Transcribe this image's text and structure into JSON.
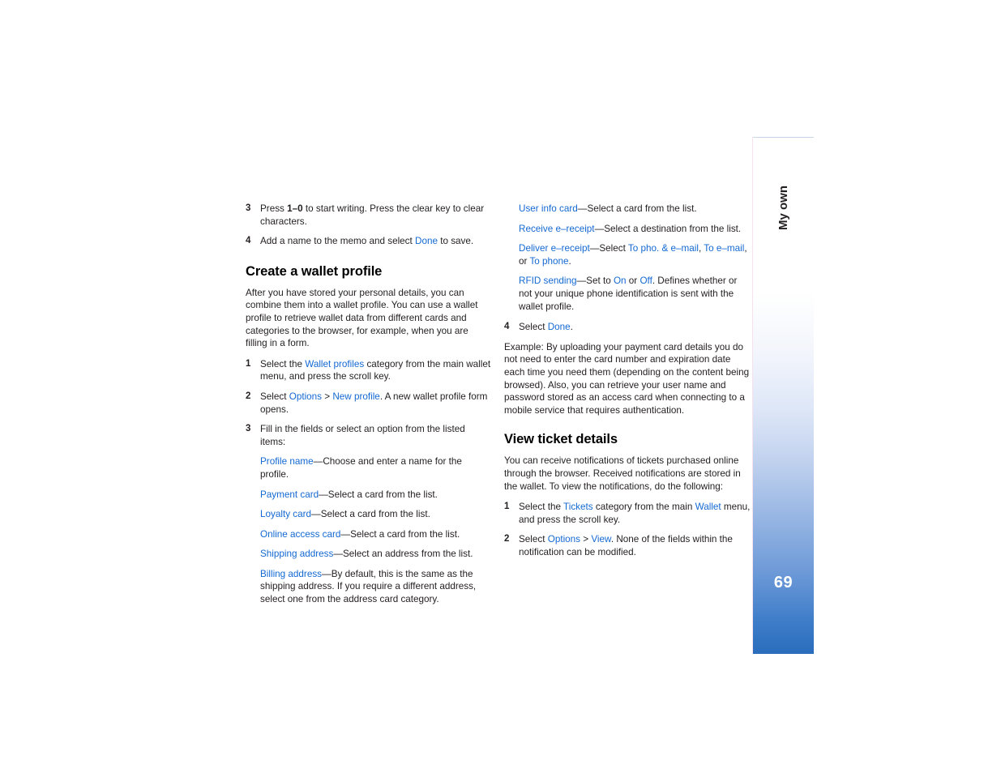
{
  "page": {
    "number": "69",
    "tab_label": "My own"
  },
  "colors": {
    "link": "#1469d3",
    "text": "#231f20",
    "tab_bottom": "#2a6dbc",
    "tab_edge": "#f6e2ec"
  },
  "left_column": {
    "steps_top": [
      {
        "num": "3",
        "parts": [
          {
            "t": "Press ",
            "s": "plain"
          },
          {
            "t": "1–0",
            "s": "bold"
          },
          {
            "t": " to start writing. Press the clear key to clear characters.",
            "s": "plain"
          }
        ]
      },
      {
        "num": "4",
        "parts": [
          {
            "t": "Add a name to the memo and select ",
            "s": "plain"
          },
          {
            "t": "Done",
            "s": "link"
          },
          {
            "t": " to save.",
            "s": "plain"
          }
        ]
      }
    ],
    "heading": "Create a wallet profile",
    "intro": "After you have stored your personal details, you can combine them into a wallet profile. You can use a wallet profile to retrieve wallet data from different cards and categories to the browser, for example, when you are filling in a form.",
    "steps": [
      {
        "num": "1",
        "parts": [
          {
            "t": "Select the ",
            "s": "plain"
          },
          {
            "t": "Wallet profiles",
            "s": "link"
          },
          {
            "t": " category from the main wallet menu, and press the scroll key.",
            "s": "plain"
          }
        ]
      },
      {
        "num": "2",
        "parts": [
          {
            "t": "Select ",
            "s": "plain"
          },
          {
            "t": "Options",
            "s": "link"
          },
          {
            "t": " > ",
            "s": "plain"
          },
          {
            "t": "New profile",
            "s": "link"
          },
          {
            "t": ". A new wallet profile form opens.",
            "s": "plain"
          }
        ]
      },
      {
        "num": "3",
        "parts": [
          {
            "t": "Fill in the fields or select an option from the listed items:",
            "s": "plain"
          }
        ]
      }
    ],
    "definitions": [
      {
        "parts": [
          {
            "t": "Profile name",
            "s": "link"
          },
          {
            "t": "—Choose and enter a name for the profile.",
            "s": "plain"
          }
        ]
      },
      {
        "parts": [
          {
            "t": "Payment card",
            "s": "link"
          },
          {
            "t": "—Select a card from the list.",
            "s": "plain"
          }
        ]
      },
      {
        "parts": [
          {
            "t": "Loyalty card",
            "s": "link"
          },
          {
            "t": "—Select a card from the list.",
            "s": "plain"
          }
        ]
      },
      {
        "parts": [
          {
            "t": "Online access card",
            "s": "link"
          },
          {
            "t": "—Select a card from the list.",
            "s": "plain"
          }
        ]
      },
      {
        "parts": [
          {
            "t": "Shipping address",
            "s": "link"
          },
          {
            "t": "—Select an address from the list.",
            "s": "plain"
          }
        ]
      },
      {
        "parts": [
          {
            "t": "Billing address",
            "s": "link"
          },
          {
            "t": "—By default, this is the same as the shipping address. If you require a different address, select one from the address card category.",
            "s": "plain"
          }
        ]
      }
    ]
  },
  "right_column": {
    "definitions": [
      {
        "parts": [
          {
            "t": "User info card",
            "s": "link"
          },
          {
            "t": "—Select a card from the list.",
            "s": "plain"
          }
        ]
      },
      {
        "parts": [
          {
            "t": "Receive e–receipt",
            "s": "link"
          },
          {
            "t": "—Select a destination from the list.",
            "s": "plain"
          }
        ]
      },
      {
        "parts": [
          {
            "t": "Deliver e–receipt",
            "s": "link"
          },
          {
            "t": "—Select ",
            "s": "plain"
          },
          {
            "t": "To pho. & e–mail",
            "s": "link"
          },
          {
            "t": ", ",
            "s": "plain"
          },
          {
            "t": "To e–mail",
            "s": "link"
          },
          {
            "t": ", or ",
            "s": "plain"
          },
          {
            "t": "To phone",
            "s": "link"
          },
          {
            "t": ".",
            "s": "plain"
          }
        ]
      },
      {
        "parts": [
          {
            "t": "RFID sending",
            "s": "link"
          },
          {
            "t": "—Set to ",
            "s": "plain"
          },
          {
            "t": "On",
            "s": "link"
          },
          {
            "t": " or ",
            "s": "plain"
          },
          {
            "t": "Off",
            "s": "link"
          },
          {
            "t": ". Defines whether or not your unique phone identification is sent with the wallet profile.",
            "s": "plain"
          }
        ]
      }
    ],
    "step_done": {
      "num": "4",
      "parts": [
        {
          "t": "Select ",
          "s": "plain"
        },
        {
          "t": "Done",
          "s": "link"
        },
        {
          "t": ".",
          "s": "plain"
        }
      ]
    },
    "example": "Example: By uploading your payment card details you do not need to enter the card number and expiration date each time you need them (depending on the content being browsed). Also, you can retrieve your user name and password stored as an access card when connecting to a mobile service that requires authentication.",
    "heading": "View ticket details",
    "intro": "You can receive notifications of tickets purchased online through the browser. Received notifications are stored in the wallet. To view the notifications, do the following:",
    "steps": [
      {
        "num": "1",
        "parts": [
          {
            "t": "Select the ",
            "s": "plain"
          },
          {
            "t": "Tickets",
            "s": "link"
          },
          {
            "t": " category from the main ",
            "s": "plain"
          },
          {
            "t": "Wallet",
            "s": "link"
          },
          {
            "t": " menu, and press the scroll key.",
            "s": "plain"
          }
        ]
      },
      {
        "num": "2",
        "parts": [
          {
            "t": "Select ",
            "s": "plain"
          },
          {
            "t": "Options",
            "s": "link"
          },
          {
            "t": " > ",
            "s": "plain"
          },
          {
            "t": "View",
            "s": "link"
          },
          {
            "t": ". None of the fields within the notification can be modified.",
            "s": "plain"
          }
        ]
      }
    ]
  }
}
